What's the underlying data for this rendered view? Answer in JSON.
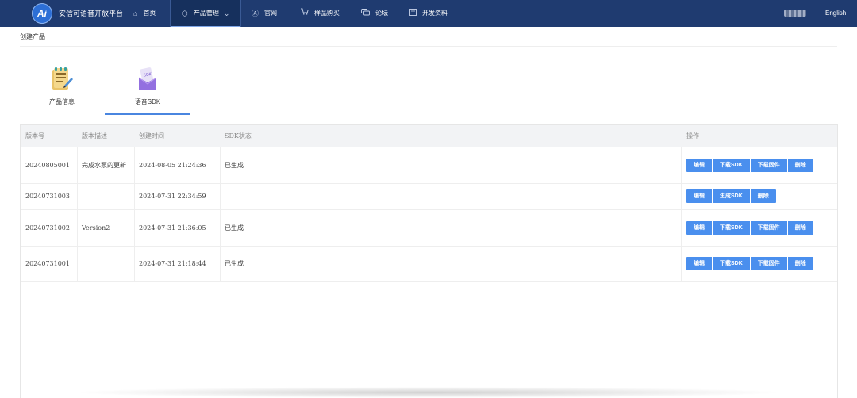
{
  "header": {
    "logo_text": "Ai",
    "brand": "安信可语音开放平台",
    "nav": [
      {
        "icon": "home-icon",
        "glyph": "⌂",
        "label": "首页"
      },
      {
        "icon": "cube-icon",
        "glyph": "⬡",
        "label": "产品管理"
      },
      {
        "icon": "ai-circle-icon",
        "glyph": "Ⓐ",
        "label": "官网"
      },
      {
        "icon": "cart-icon",
        "glyph": "🛒",
        "label": "样品购买"
      },
      {
        "icon": "chat-icon",
        "glyph": "💬",
        "label": "论坛"
      },
      {
        "icon": "doc-icon",
        "glyph": "▢",
        "label": "开发资料"
      }
    ],
    "dropdown_glyph": "⌄",
    "language": "English"
  },
  "breadcrumb": "创建产品",
  "product_tabs": [
    {
      "label": "产品信息",
      "icon": "product-info-icon"
    },
    {
      "label": "语音SDK",
      "icon": "voice-sdk-icon",
      "badge": "SDK"
    }
  ],
  "table": {
    "columns": [
      "版本号",
      "版本描述",
      "创建时间",
      "SDK状态",
      "操作"
    ],
    "rows": [
      {
        "version": "20240805001",
        "desc": "完成水泵的更新",
        "time": "2024-08-05 21:24:36",
        "status": "已生成",
        "actions": [
          "编辑",
          "下载SDK",
          "下载固件",
          "删除"
        ]
      },
      {
        "version": "20240731003",
        "desc": "",
        "time": "2024-07-31 22:34:59",
        "status": "",
        "actions": [
          "编辑",
          "生成SDK",
          "删除"
        ]
      },
      {
        "version": "20240731002",
        "desc": "Version2",
        "time": "2024-07-31 21:36:05",
        "status": "已生成",
        "actions": [
          "编辑",
          "下载SDK",
          "下载固件",
          "删除"
        ]
      },
      {
        "version": "20240731001",
        "desc": "",
        "time": "2024-07-31 21:18:44",
        "status": "已生成",
        "actions": [
          "编辑",
          "下载SDK",
          "下载固件",
          "删除"
        ]
      }
    ]
  },
  "colors": {
    "nav_bg": "#1f3b70",
    "accent": "#4a8fee",
    "table_header_bg": "#f2f3f5"
  }
}
